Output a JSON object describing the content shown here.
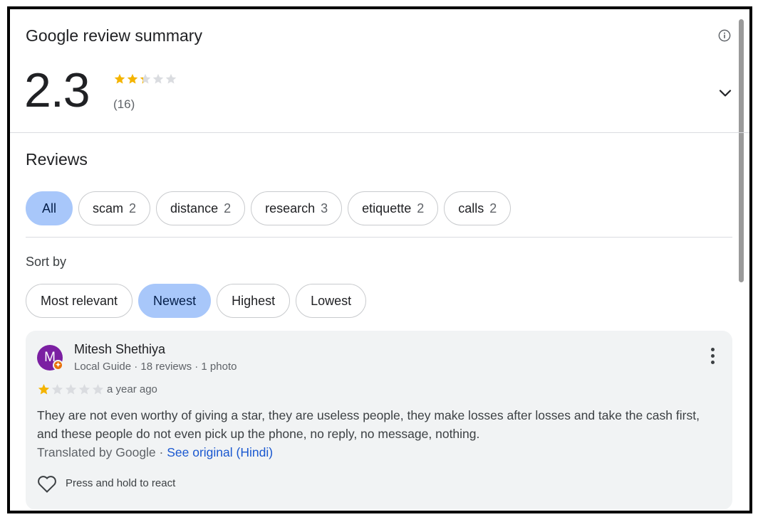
{
  "summary": {
    "title": "Google review summary",
    "rating": "2.3",
    "rating_value": 2.3,
    "count": "(16)",
    "star_color": "#f4b400",
    "empty_star_color": "#dadce0"
  },
  "reviews": {
    "title": "Reviews",
    "topics": [
      {
        "label": "All",
        "count": ""
      },
      {
        "label": "scam",
        "count": "2"
      },
      {
        "label": "distance",
        "count": "2"
      },
      {
        "label": "research",
        "count": "3"
      },
      {
        "label": "etiquette",
        "count": "2"
      },
      {
        "label": "calls",
        "count": "2"
      }
    ],
    "sort_label": "Sort by",
    "sort_options": [
      "Most relevant",
      "Newest",
      "Highest",
      "Lowest"
    ],
    "active_sort": "Newest",
    "accent_color": "#a8c7fa"
  },
  "review": {
    "avatar_letter": "M",
    "author": "Mitesh Shethiya",
    "meta": "Local Guide · 18 reviews · 1 photo",
    "rating_value": 1,
    "time": "a year ago",
    "text": "They are not even worthy of giving a star, they are useless people, they make losses after losses and take the cash first, and these people do not even pick up the phone, no reply, no message, nothing.",
    "translated_prefix": "Translated by Google · ",
    "see_original": "See original (Hindi)",
    "react_label": "Press and hold to react"
  }
}
